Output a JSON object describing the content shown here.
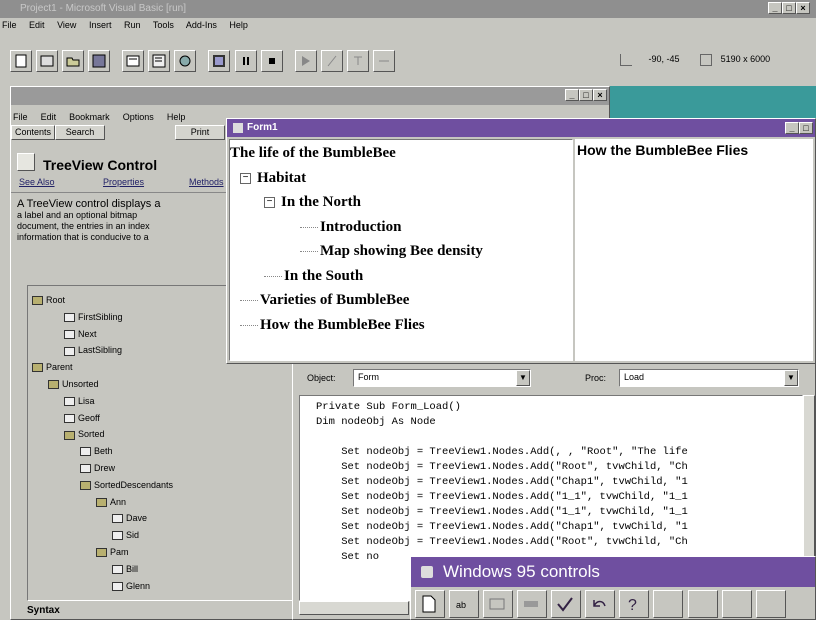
{
  "vb": {
    "title": "Project1 - Microsoft Visual Basic [run]",
    "menu": [
      "File",
      "Edit",
      "View",
      "Insert",
      "Run",
      "Tools",
      "Add-Ins",
      "Help"
    ],
    "coords": "-90, -45",
    "size": "5190 x 6000"
  },
  "help": {
    "menu": [
      "File",
      "Edit",
      "Bookmark",
      "Options",
      "Help"
    ],
    "buttons": [
      "Contents",
      "Search",
      "Print"
    ],
    "topic_title": "TreeView Control",
    "links": [
      "See Also",
      "Properties",
      "Methods"
    ],
    "desc_lines": [
      "A TreeView control displays a",
      "a label and an optional bitmap",
      "document, the entries in an index",
      "information that is conducive to a"
    ],
    "tree": [
      {
        "label": "Root",
        "level": 0
      },
      {
        "label": "FirstSibling",
        "level": 2
      },
      {
        "label": "Next",
        "level": 2
      },
      {
        "label": "LastSibling",
        "level": 2
      },
      {
        "label": "Parent",
        "level": 0
      },
      {
        "label": "Unsorted",
        "level": 1
      },
      {
        "label": "Lisa",
        "level": 2
      },
      {
        "label": "Geoff",
        "level": 2
      },
      {
        "label": "Sorted",
        "level": 2
      },
      {
        "label": "Beth",
        "level": 3
      },
      {
        "label": "Drew",
        "level": 3
      },
      {
        "label": "SortedDescendants",
        "level": 3
      },
      {
        "label": "Ann",
        "level": 4
      },
      {
        "label": "Dave",
        "level": 5
      },
      {
        "label": "Sid",
        "level": 5
      },
      {
        "label": "Pam",
        "level": 4
      },
      {
        "label": "Bill",
        "level": 5
      },
      {
        "label": "Glenn",
        "level": 5
      }
    ],
    "syntax_label": "Syntax"
  },
  "form1": {
    "title": "Form1",
    "tree": [
      "The life of the BumbleBee",
      "Habitat",
      "In the North",
      "Introduction",
      "Map showing Bee density",
      "In the South",
      "Varieties of BumbleBee",
      "How the BumbleBee Flies"
    ],
    "detail": "How the BumbleBee Flies"
  },
  "code": {
    "object_label": "Object:",
    "object_value": "Form",
    "proc_label": "Proc:",
    "proc_value": "Load",
    "lines": [
      "Private Sub Form_Load()",
      "Dim nodeObj As Node",
      "",
      "    Set nodeObj = TreeView1.Nodes.Add(, , \"Root\", \"The life",
      "    Set nodeObj = TreeView1.Nodes.Add(\"Root\", tvwChild, \"Ch",
      "    Set nodeObj = TreeView1.Nodes.Add(\"Chap1\", tvwChild, \"1",
      "    Set nodeObj = TreeView1.Nodes.Add(\"1_1\", tvwChild, \"1_1",
      "    Set nodeObj = TreeView1.Nodes.Add(\"1_1\", tvwChild, \"1_1",
      "    Set nodeObj = TreeView1.Nodes.Add(\"Chap1\", tvwChild, \"1",
      "    Set nodeObj = TreeView1.Nodes.Add(\"Root\", tvwChild, \"Ch",
      "    Set no"
    ]
  },
  "win95": {
    "title": "Windows 95 controls"
  },
  "colors": {
    "titlebar": "#6f4fa0",
    "titlebar_inactive": "#8a8a8a",
    "desktop": "#c6c6c0",
    "teal": "#3a9a9a"
  }
}
